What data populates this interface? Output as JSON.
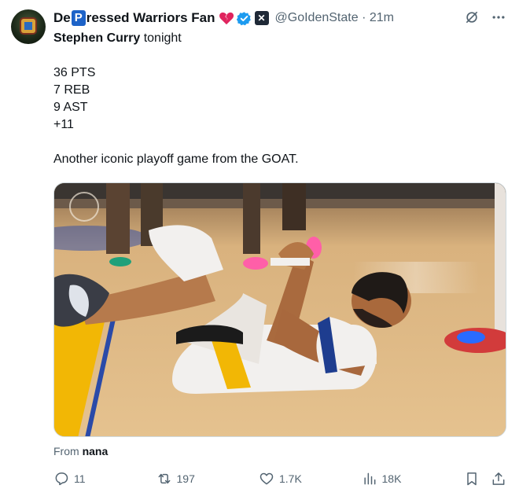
{
  "post": {
    "author_name_pre": "De",
    "author_name_badge": "P",
    "author_name_post": "ressed Warriors Fan",
    "handle": "@GoIdenState",
    "separator": "·",
    "time": "21m",
    "subject": "Stephen Curry",
    "subject_rest": " tonight",
    "stats": [
      "36 PTS",
      "7 REB",
      "9 AST",
      "+11"
    ],
    "caption": "Another iconic playoff game from the GOAT.",
    "from_label": "From",
    "from_user": "nana"
  },
  "actions": {
    "replies": "11",
    "reposts": "197",
    "likes": "1.7K",
    "views": "18K"
  },
  "icons": {
    "heart": "broken-heart-icon",
    "verified": "verified-badge-icon",
    "x": "x-badge-icon",
    "grok": "grok-icon",
    "more": "more-icon",
    "reply": "reply-icon",
    "repost": "repost-icon",
    "like": "like-icon",
    "views": "views-icon",
    "bookmark": "bookmark-icon",
    "share": "share-icon"
  },
  "colors": {
    "accent": "#1d9bf0",
    "muted": "#536471",
    "heart": "#e0245e"
  }
}
